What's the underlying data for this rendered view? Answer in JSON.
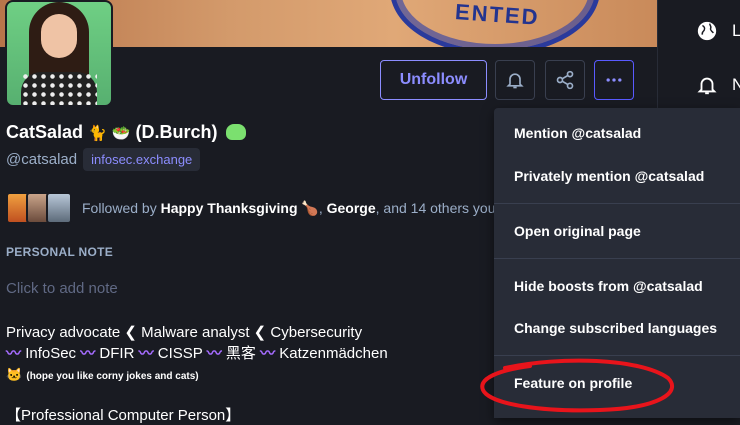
{
  "header": {
    "banner_stamp_text": "ENTED"
  },
  "actions": {
    "unfollow_label": "Unfollow"
  },
  "nav": {
    "items": [
      {
        "label": "L",
        "icon": "globe-icon"
      },
      {
        "label": "N",
        "icon": "bell-icon"
      }
    ]
  },
  "profile": {
    "display_name": "CatSalad",
    "display_name_suffix": "(D.Burch)",
    "handle": "@catsalad",
    "server": "infosec.exchange",
    "followed_by_prefix": "Followed by",
    "followed_by_1": "Happy Thanksgiving",
    "followed_by_sep": ",",
    "followed_by_2": "George",
    "followed_by_rest": ", and 14 others you"
  },
  "note": {
    "label": "PERSONAL NOTE",
    "placeholder": "Click to add note"
  },
  "bio": {
    "line1": "Privacy advocate ❮  Malware analyst ❮  Cybersecurity",
    "line2_items": [
      "InfoSec",
      "DFIR",
      "CISSP",
      "黑客",
      "Katzenmädchen"
    ],
    "line3": "(hope you like corny jokes and cats)",
    "line4": "【Professional Computer Person】"
  },
  "dropdown": {
    "items": [
      "Mention @catsalad",
      "Privately mention @catsalad",
      "Open original page",
      "Hide boosts from @catsalad",
      "Change subscribed languages",
      "Feature on profile"
    ]
  },
  "colors": {
    "accent": "#8c8dff",
    "background": "#191b22",
    "menu_bg": "#282c37",
    "annotation_red": "#e8141b"
  }
}
